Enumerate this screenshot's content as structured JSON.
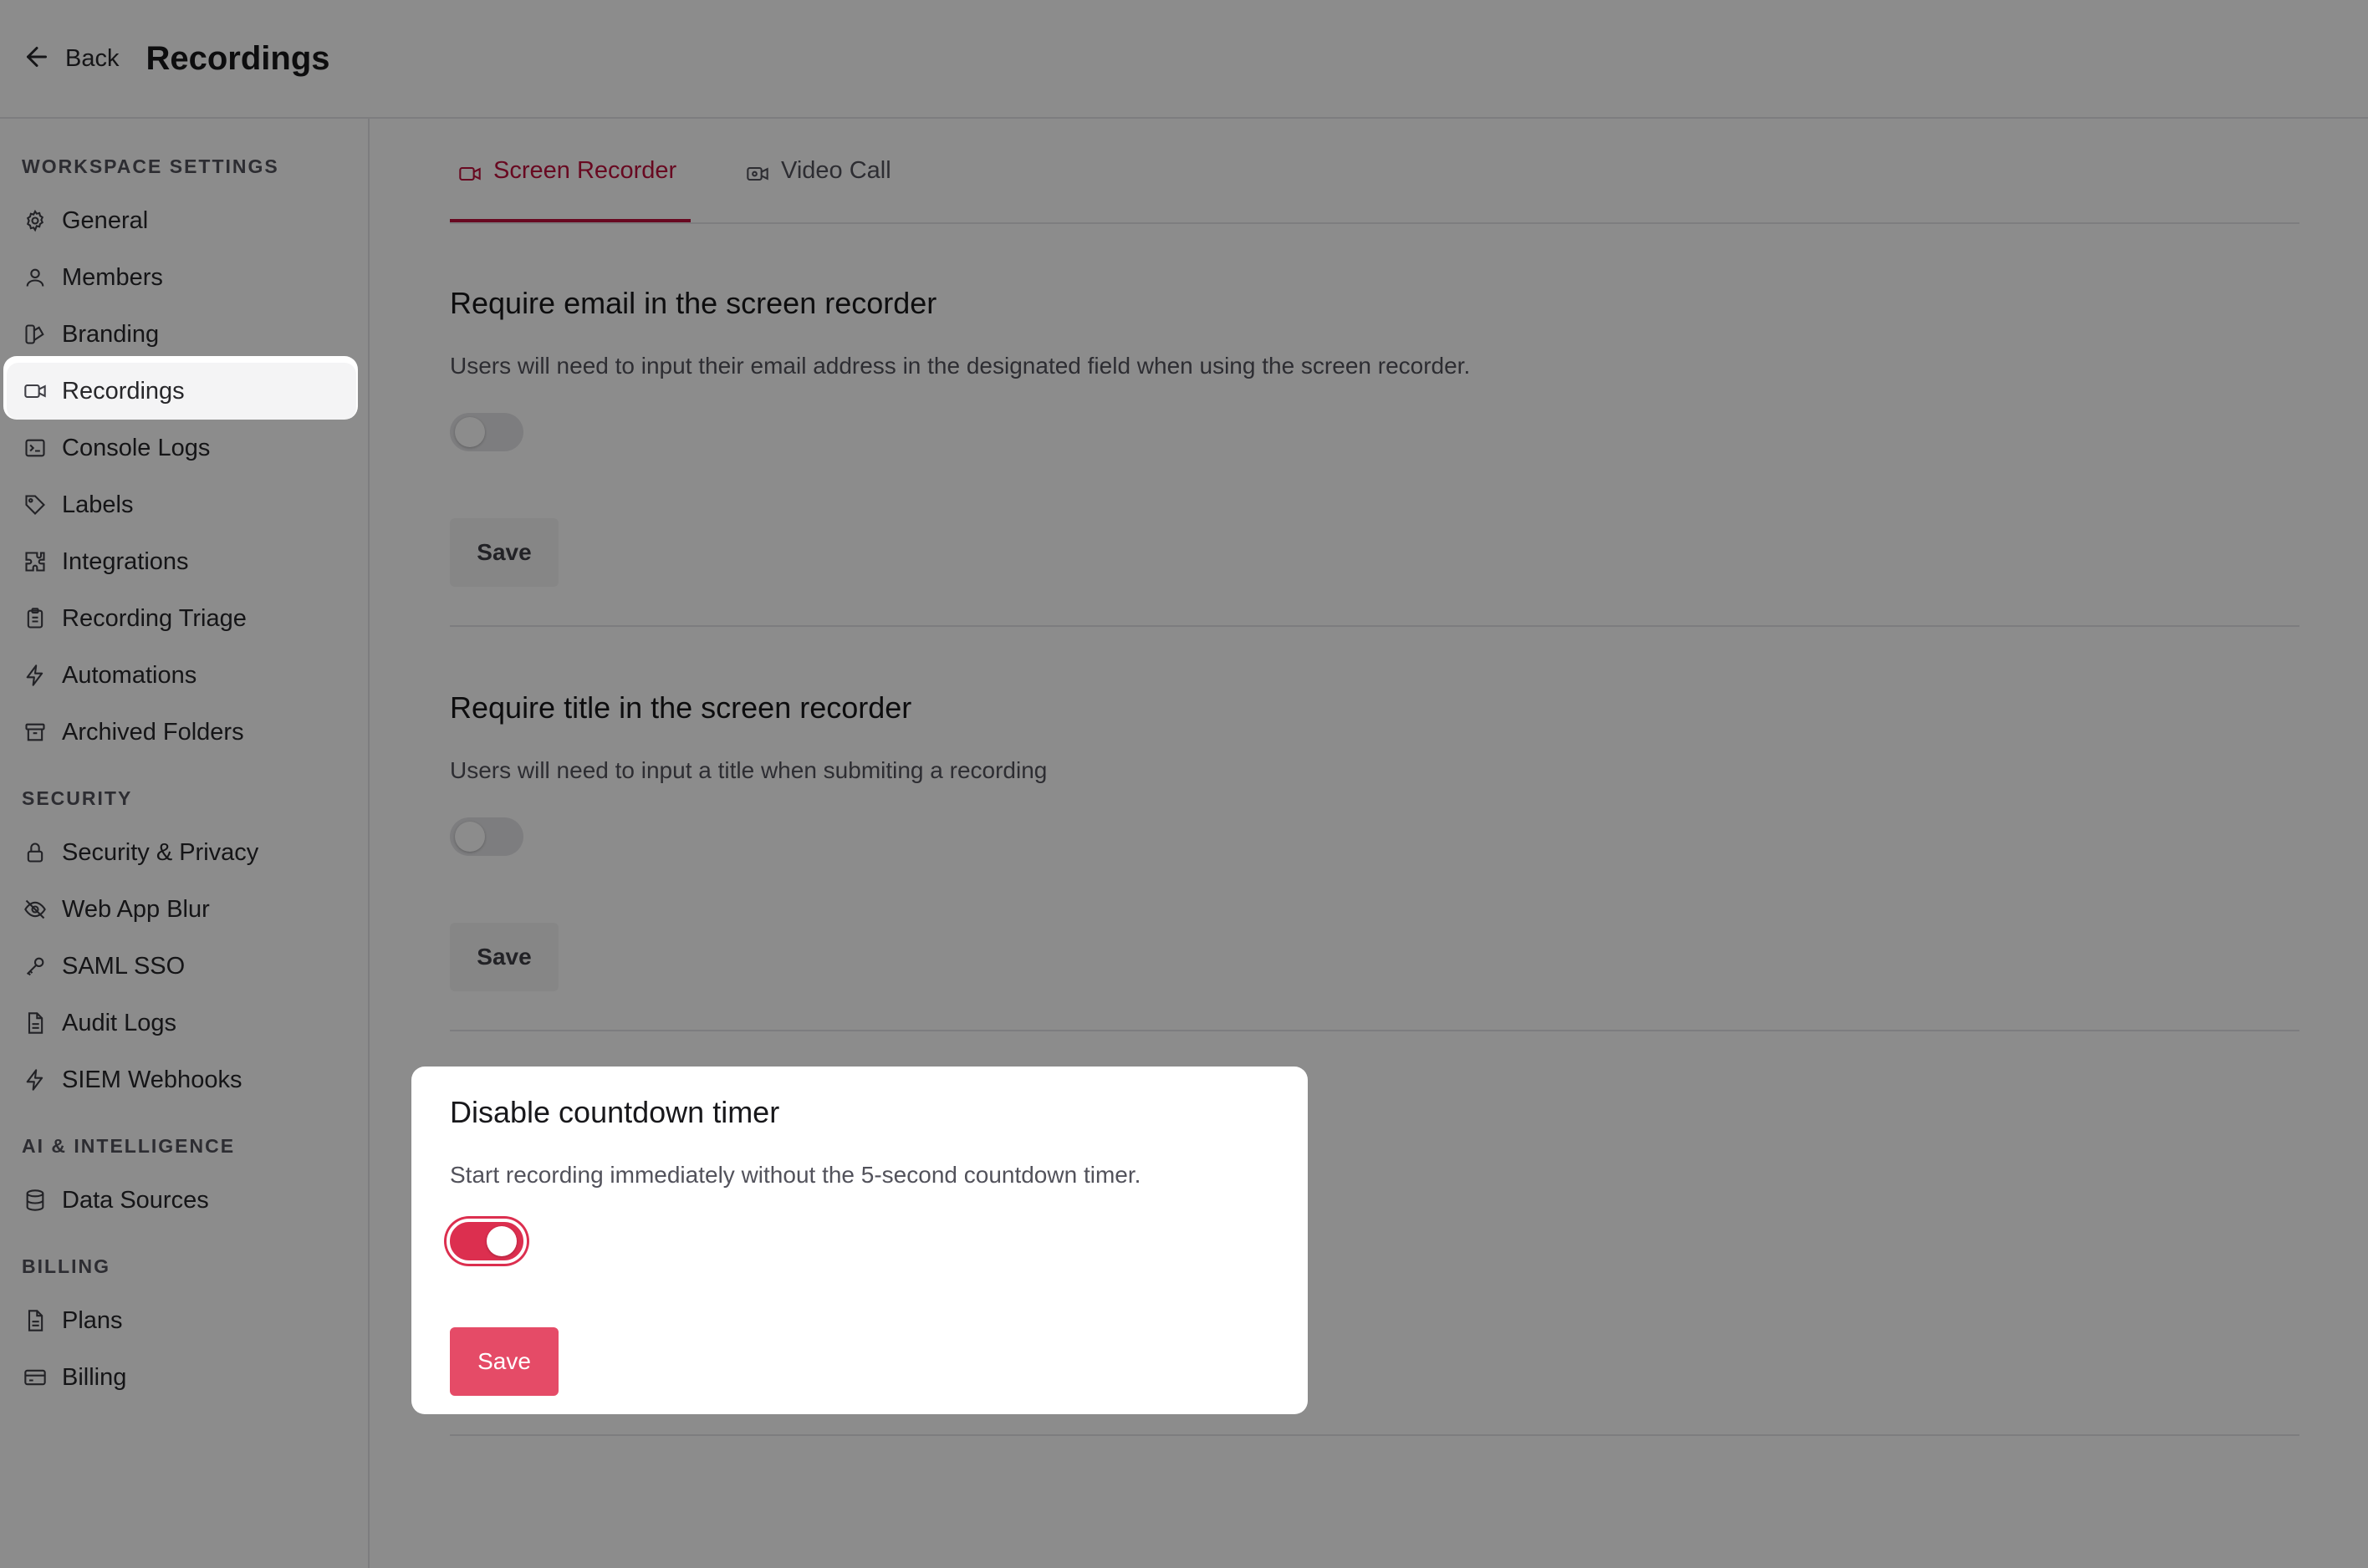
{
  "header": {
    "back_label": "Back",
    "title": "Recordings"
  },
  "sidebar": {
    "sections": [
      {
        "title": "WORKSPACE SETTINGS",
        "items": [
          {
            "label": "General",
            "icon": "gear-icon"
          },
          {
            "label": "Members",
            "icon": "users-icon"
          },
          {
            "label": "Branding",
            "icon": "palette-icon"
          },
          {
            "label": "Recordings",
            "icon": "video-icon",
            "active": true
          },
          {
            "label": "Console Logs",
            "icon": "terminal-icon"
          },
          {
            "label": "Labels",
            "icon": "tag-icon"
          },
          {
            "label": "Integrations",
            "icon": "puzzle-icon"
          },
          {
            "label": "Recording Triage",
            "icon": "clipboard-icon"
          },
          {
            "label": "Automations",
            "icon": "lightning-icon"
          },
          {
            "label": "Archived Folders",
            "icon": "archive-icon"
          }
        ]
      },
      {
        "title": "SECURITY",
        "items": [
          {
            "label": "Security & Privacy",
            "icon": "lock-icon"
          },
          {
            "label": "Web App Blur",
            "icon": "eye-off-icon"
          },
          {
            "label": "SAML SSO",
            "icon": "key-icon"
          },
          {
            "label": "Audit Logs",
            "icon": "document-icon"
          },
          {
            "label": "SIEM Webhooks",
            "icon": "lightning-icon"
          }
        ]
      },
      {
        "title": "AI & INTELLIGENCE",
        "items": [
          {
            "label": "Data Sources",
            "icon": "database-icon"
          }
        ]
      },
      {
        "title": "BILLING",
        "items": [
          {
            "label": "Plans",
            "icon": "document-icon"
          },
          {
            "label": "Billing",
            "icon": "credit-card-icon"
          }
        ]
      }
    ]
  },
  "tabs": [
    {
      "label": "Screen Recorder",
      "icon": "video-icon",
      "active": true
    },
    {
      "label": "Video Call",
      "icon": "video-call-icon",
      "active": false
    }
  ],
  "settings": [
    {
      "title": "Require email in the screen recorder",
      "description": "Users will need to input their email address in the designated field when using the screen recorder.",
      "enabled": false,
      "save_label": "Save"
    },
    {
      "title": "Require title in the screen recorder",
      "description": "Users will need to input a title when submiting a recording",
      "enabled": false,
      "save_label": "Save"
    },
    {
      "title": "Disable countdown timer",
      "description": "Start recording immediately without the 5-second countdown timer.",
      "enabled": true,
      "save_label": "Save"
    }
  ],
  "colors": {
    "accent": "#be123c",
    "primary_button": "#e54b67",
    "toggle_on": "#dc2f4f",
    "overlay": "rgba(0,0,0,0.45)"
  }
}
